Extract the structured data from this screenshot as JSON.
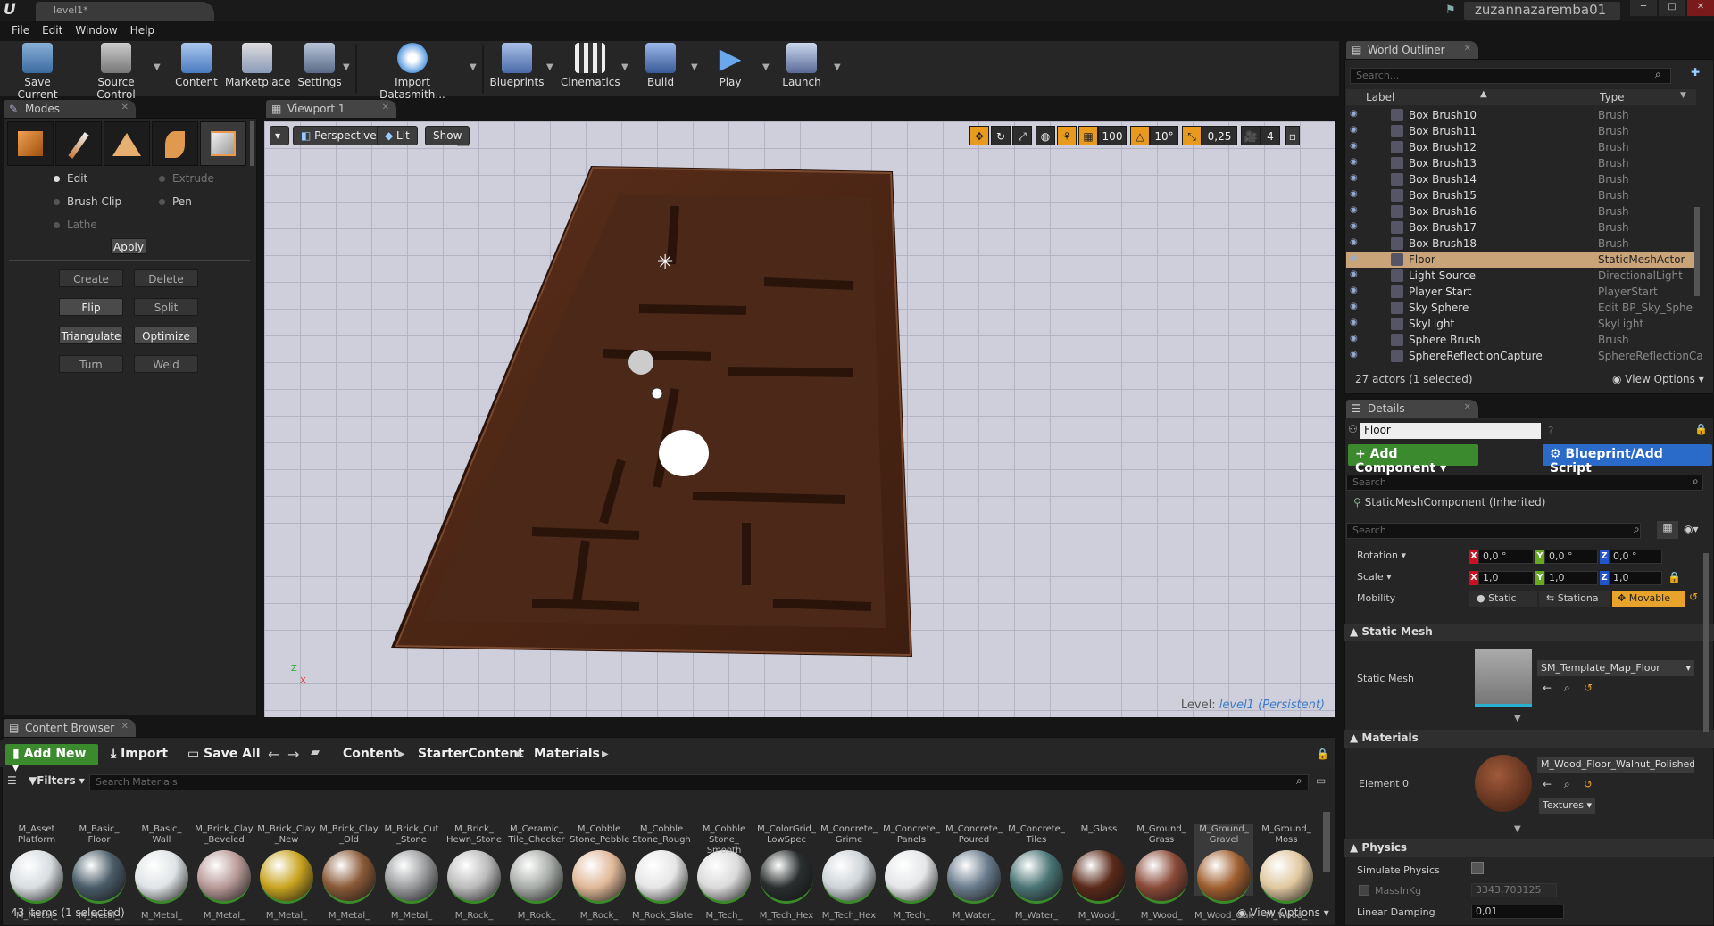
{
  "title_bar": {
    "tab": "level1*",
    "user": "zuzannazaremba01"
  },
  "menu": [
    "File",
    "Edit",
    "Window",
    "Help"
  ],
  "toolbar": [
    "Save Current",
    "Source Control",
    "Content",
    "Marketplace",
    "Settings",
    "Import Datasmith...",
    "Blueprints",
    "Cinematics",
    "Build",
    "Play",
    "Launch"
  ],
  "modes": {
    "tab": "Modes",
    "edit": "Edit",
    "extrude": "Extrude",
    "brush_clip": "Brush Clip",
    "pen": "Pen",
    "lathe": "Lathe",
    "apply": "Apply",
    "buttons": [
      "Create",
      "Delete",
      "Flip",
      "Split",
      "Triangulate",
      "Optimize",
      "Turn",
      "Weld"
    ]
  },
  "viewport": {
    "tab": "Viewport 1",
    "perspective": "Perspective",
    "lit": "Lit",
    "show": "Show",
    "grid_snap": "100",
    "rot_snap": "10°",
    "scale_snap": "0,25",
    "cam_speed": "4",
    "level_prefix": "Level:",
    "level_name": "level1 (Persistent)"
  },
  "outliner": {
    "tab": "World Outliner",
    "search_placeholder": "Search...",
    "col_label": "Label",
    "col_type": "Type",
    "rows": [
      {
        "label": "Box Brush10",
        "type": "Brush"
      },
      {
        "label": "Box Brush11",
        "type": "Brush"
      },
      {
        "label": "Box Brush12",
        "type": "Brush"
      },
      {
        "label": "Box Brush13",
        "type": "Brush"
      },
      {
        "label": "Box Brush14",
        "type": "Brush"
      },
      {
        "label": "Box Brush15",
        "type": "Brush"
      },
      {
        "label": "Box Brush16",
        "type": "Brush"
      },
      {
        "label": "Box Brush17",
        "type": "Brush"
      },
      {
        "label": "Box Brush18",
        "type": "Brush"
      },
      {
        "label": "Floor",
        "type": "StaticMeshActor"
      },
      {
        "label": "Light Source",
        "type": "DirectionalLight"
      },
      {
        "label": "Player Start",
        "type": "PlayerStart"
      },
      {
        "label": "Sky Sphere",
        "type": "Edit BP_Sky_Sphe"
      },
      {
        "label": "SkyLight",
        "type": "SkyLight"
      },
      {
        "label": "Sphere Brush",
        "type": "Brush"
      },
      {
        "label": "SphereReflectionCapture",
        "type": "SphereReflectionCa"
      }
    ],
    "count": "27 actors (1 selected)",
    "view_options": "View Options"
  },
  "details": {
    "tab": "Details",
    "name": "Floor",
    "add_component": "+ Add Component",
    "blueprint": "Blueprint/Add Script",
    "search": "Search",
    "component": "StaticMeshComponent (Inherited)",
    "rotation": "Rotation",
    "scale": "Scale",
    "mobility": "Mobility",
    "rot_x": "0,0 °",
    "rot_y": "0,0 °",
    "rot_z": "0,0 °",
    "scale_x": "1,0",
    "scale_y": "1,0",
    "scale_z": "1,0",
    "mob_static": "Static",
    "mob_stationary": "Stationa",
    "mob_movable": "Movable",
    "static_mesh_section": "Static Mesh",
    "static_mesh_label": "Static Mesh",
    "static_mesh_value": "SM_Template_Map_Floor",
    "materials_section": "Materials",
    "element0": "Element 0",
    "material_value": "M_Wood_Floor_Walnut_Polished",
    "textures": "Textures",
    "physics_section": "Physics",
    "simulate_physics": "Simulate Physics",
    "mass": "MassInKg",
    "mass_value": "3343,703125",
    "linear_damping": "Linear Damping",
    "linear_damping_value": "0,01"
  },
  "content_browser": {
    "tab": "Content Browser",
    "add_new": "Add New",
    "import": "Import",
    "save_all": "Save All",
    "path": [
      "Content",
      "StarterContent",
      "Materials"
    ],
    "filters": "Filters",
    "search_placeholder": "Search Materials",
    "status": "43 items (1 selected)",
    "view_options": "View Options",
    "assets": [
      {
        "top": "M_Asset Platform",
        "bottom": "M_Metal_",
        "color": "#d8dde0"
      },
      {
        "top": "M_Basic_ Floor",
        "bottom": "M_Metal_",
        "color": "#4a5c68"
      },
      {
        "top": "M_Basic_ Wall",
        "bottom": "M_Metal_",
        "color": "#e0e4e6"
      },
      {
        "top": "M_Brick_Clay _Beveled",
        "bottom": "M_Metal_",
        "color": "#b89a98"
      },
      {
        "top": "M_Brick_Clay _New",
        "bottom": "M_Metal_",
        "color": "#c8a420"
      },
      {
        "top": "M_Brick_Clay _Old",
        "bottom": "M_Metal_",
        "color": "#8a5a38"
      },
      {
        "top": "M_Brick_Cut _Stone",
        "bottom": "M_Metal_",
        "color": "#9a9c9e"
      },
      {
        "top": "M_Brick_ Hewn_Stone",
        "bottom": "M_Rock_",
        "color": "#bbbbbb"
      },
      {
        "top": "M_Ceramic_ Tile_Checker",
        "bottom": "M_Rock_",
        "color": "#a8aca8"
      },
      {
        "top": "M_Cobble Stone_Pebble",
        "bottom": "M_Rock_",
        "color": "#e0b898"
      },
      {
        "top": "M_Cobble Stone_Rough",
        "bottom": "M_Rock_Slate",
        "color": "#e6e6e6"
      },
      {
        "top": "M_Cobble Stone_ Smooth",
        "bottom": "M_Tech_",
        "color": "#dadada"
      },
      {
        "top": "M_ColorGrid_ LowSpec",
        "bottom": "M_Tech_Hex",
        "color": "#2a2e2e"
      },
      {
        "top": "M_Concrete_ Grime",
        "bottom": "M_Tech_Hex",
        "color": "#cfd4d8"
      },
      {
        "top": "M_Concrete_ Panels",
        "bottom": "M_Tech_",
        "color": "#e4e6e8"
      },
      {
        "top": "M_Concrete_ Poured",
        "bottom": "M_Water_",
        "color": "#6a7c8c"
      },
      {
        "top": "M_Concrete_ Tiles",
        "bottom": "M_Water_",
        "color": "#4a7474"
      },
      {
        "top": "M_Glass",
        "bottom": "M_Wood_",
        "color": "#5a2a1a"
      },
      {
        "top": "M_Ground_ Grass",
        "bottom": "M_Wood_",
        "color": "#8a4a38"
      },
      {
        "top": "M_Ground_ Gravel",
        "bottom": "M_Wood_Oak",
        "color": "#a06030"
      },
      {
        "top": "M_Ground_ Moss",
        "bottom": "M_Wood_",
        "color": "#e0c8a0"
      }
    ]
  }
}
